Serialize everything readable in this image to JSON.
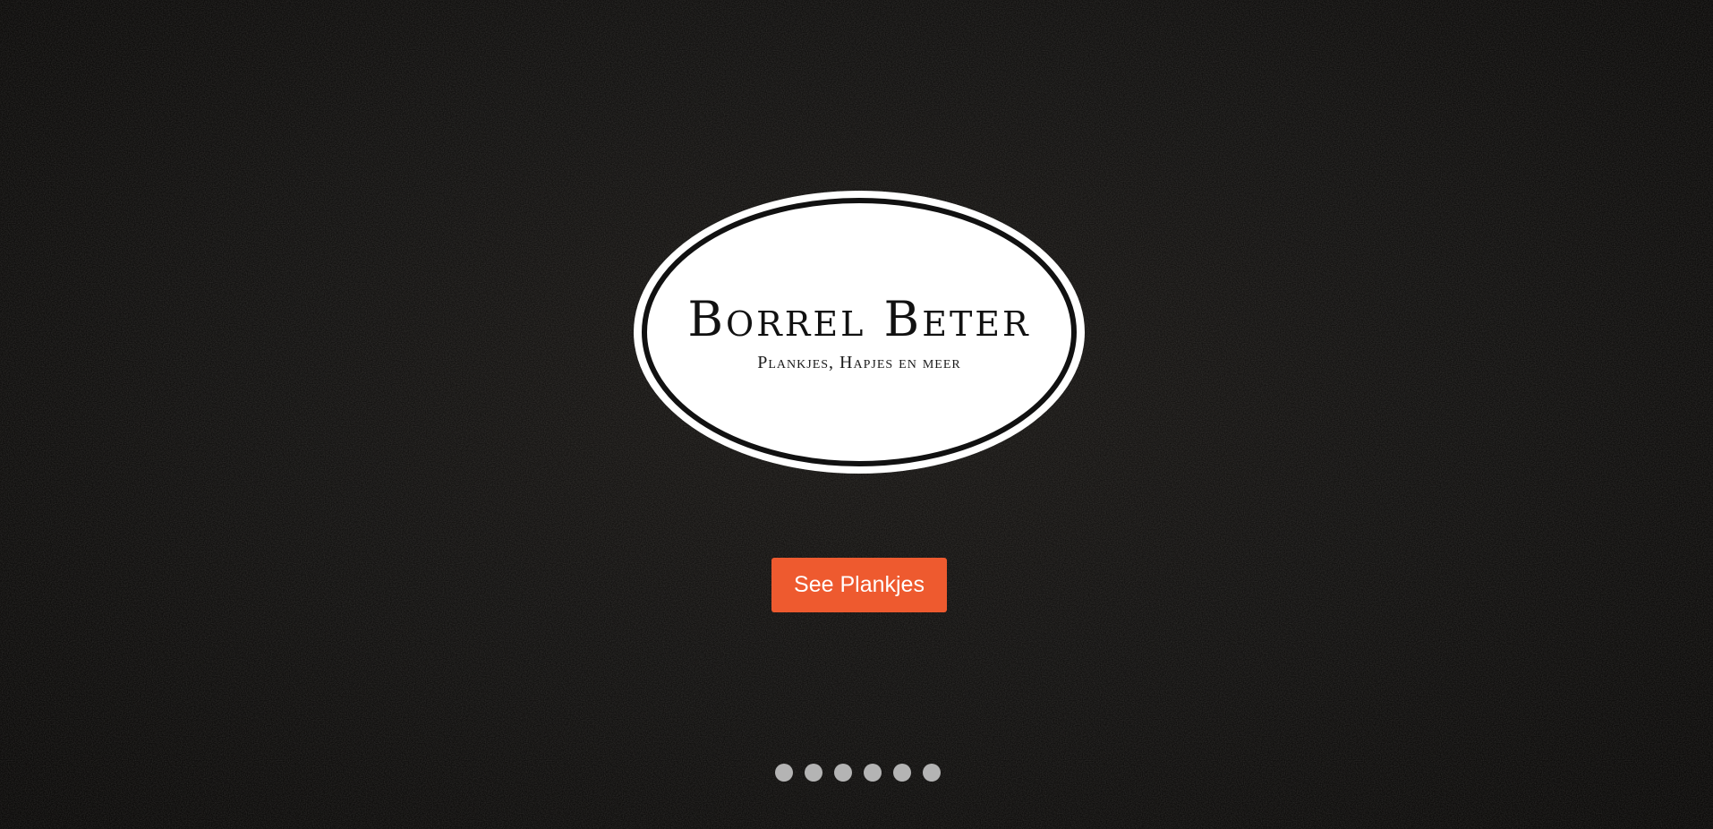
{
  "hero": {
    "logo": {
      "title": "Borrel Beter",
      "subtitle": "Plankjes, Hapjes en meer"
    },
    "cta_label": "See Plankjes",
    "slides": [
      {
        "label": "slide 1"
      },
      {
        "label": "slide 2"
      },
      {
        "label": "slide 3"
      },
      {
        "label": "slide 4"
      },
      {
        "label": "slide 5"
      },
      {
        "label": "slide 6"
      }
    ]
  },
  "colors": {
    "background": "#0e0d0c",
    "accent": "#ee5a2f",
    "logo_fill": "#ffffff",
    "dot": "#b4b4b4"
  }
}
